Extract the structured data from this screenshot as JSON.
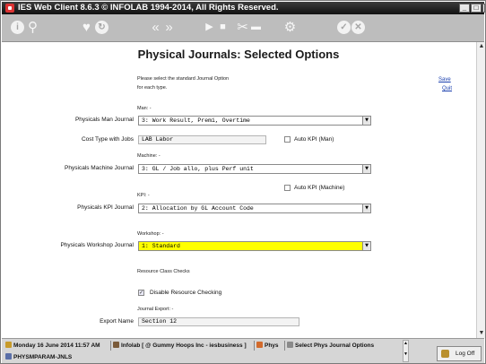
{
  "window": {
    "title": "IES Web Client 8.6.3 © INFOLAB 1994-2014, All Rights Reserved.",
    "controls": {
      "minimize": "_",
      "maximize": "□",
      "close": ""
    }
  },
  "toolbar": {
    "icons": [
      {
        "name": "info-icon",
        "glyph": "i"
      },
      {
        "name": "search-icon",
        "glyph": "⚲"
      },
      {
        "name": "heart-icon",
        "glyph": "♥"
      },
      {
        "name": "refresh-icon",
        "glyph": "↻"
      },
      {
        "name": "rewind-icon",
        "glyph": "«"
      },
      {
        "name": "fast-forward-icon",
        "glyph": "»"
      },
      {
        "name": "play-icon",
        "glyph": "▶"
      },
      {
        "name": "stop-icon",
        "glyph": "■"
      },
      {
        "name": "tools-icon",
        "glyph": "✂"
      },
      {
        "name": "clipboard-icon",
        "glyph": "▬"
      },
      {
        "name": "settings-icon",
        "glyph": "⚙"
      },
      {
        "name": "ok-icon",
        "glyph": "✓"
      },
      {
        "name": "cancel-icon",
        "glyph": "✕"
      }
    ]
  },
  "page": {
    "title": "Physical Journals: Selected Options",
    "intro_line1": "Please select the standard Journal Option",
    "intro_line2": "for each type.",
    "save_link": "Save",
    "quit_link": "Quit"
  },
  "form": {
    "man_section": "Man: -",
    "man_journal_label": "Physicals Man Journal",
    "man_journal_value": "3: Work Result, Premi, Overtime",
    "cost_type_label": "Cost Type with Jobs",
    "cost_type_value": "LAB Labor",
    "auto_kpi_man_label": "Auto KPI (Man)",
    "auto_kpi_man_checked": false,
    "machine_section": "Machine: -",
    "machine_journal_label": "Physicals Machine Journal",
    "machine_journal_value": "3: GL / Job allo, plus Perf unit",
    "auto_kpi_machine_label": "Auto KPI (Machine)",
    "auto_kpi_machine_checked": false,
    "kpi_section": "KPI: -",
    "kpi_journal_label": "Physicals KPI Journal",
    "kpi_journal_value": "2: Allocation by GL Account Code",
    "workshop_section": "Workshop: -",
    "workshop_journal_label": "Physicals Workshop Journal",
    "workshop_journal_value": "1: Standard",
    "resource_section": "Resource Class Checks",
    "disable_resource_label": "Disable Resource Checking",
    "disable_resource_checked": true,
    "journal_export_section": "Journal Export: -",
    "export_name_label": "Export Name",
    "export_name_value": "Section 12"
  },
  "statusbar": {
    "date": "Monday 16 June 2014 11:57 AM",
    "company": "Infolab [ @ Gummy Hoops Inc - iesbusiness ]",
    "module": "Phys",
    "screen": "Select Phys Journal Options",
    "program": "PHYSMPARAM-JNLS",
    "logoff": "Log Off"
  },
  "colors": {
    "highlight": "#ffff00",
    "titlebar": "#1a1a1a",
    "toolbar": "#bdbdbd",
    "link": "#1a3fae"
  }
}
